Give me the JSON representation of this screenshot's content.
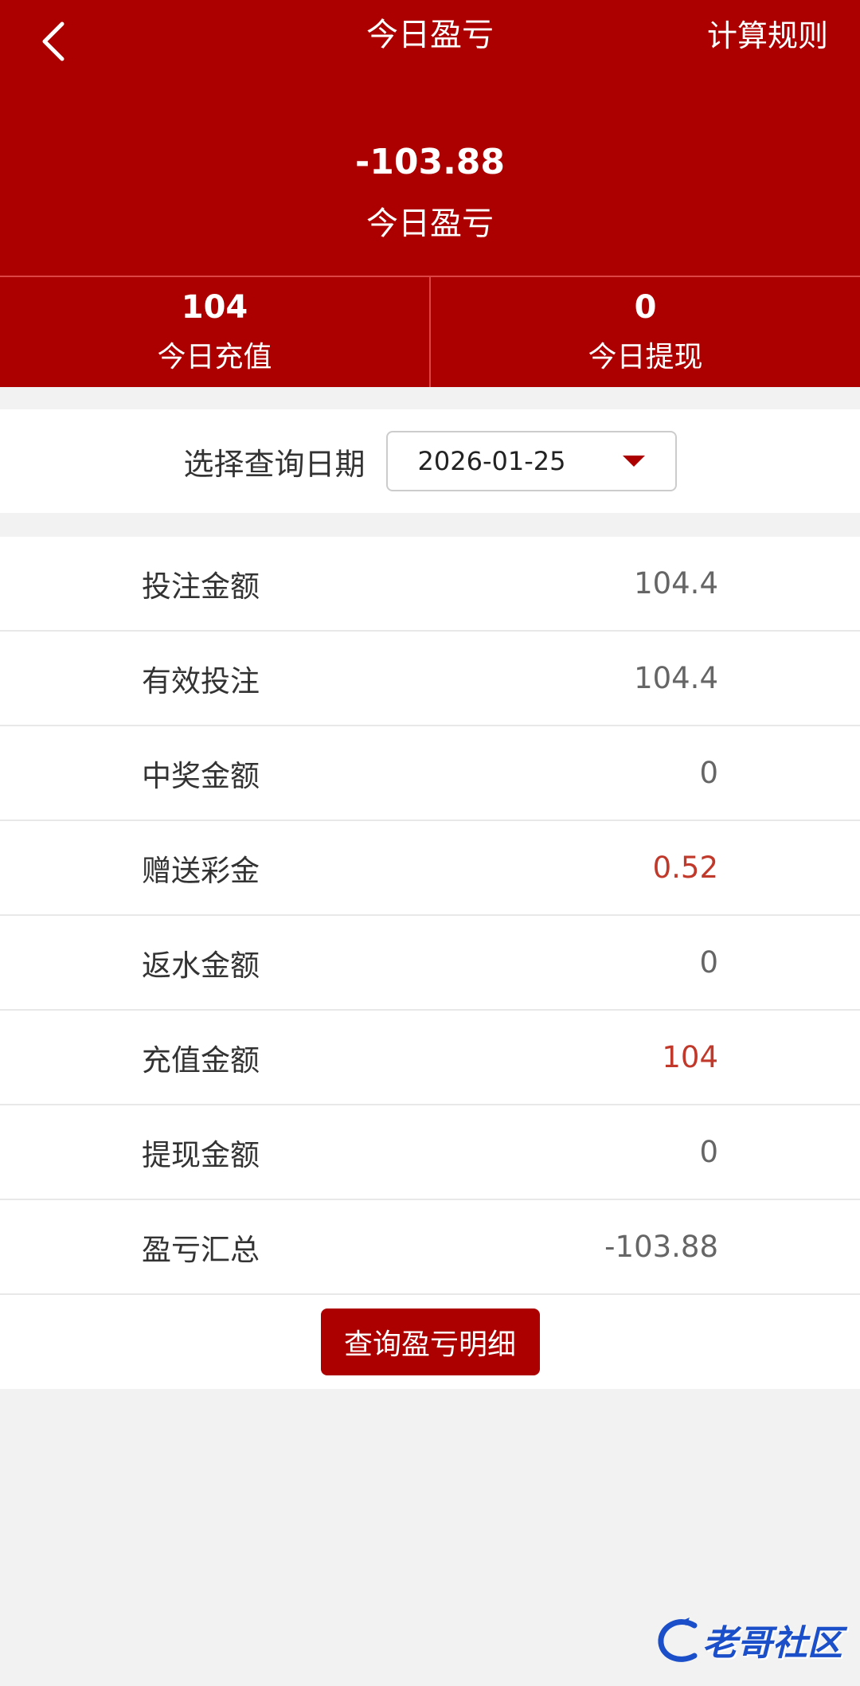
{
  "header": {
    "title": "今日盈亏",
    "rules_label": "计算规则",
    "total_value": "-103.88",
    "total_label": "今日盈亏"
  },
  "stats": [
    {
      "value": "104",
      "label": "今日充值"
    },
    {
      "value": "0",
      "label": "今日提现"
    }
  ],
  "date_filter": {
    "label": "选择查询日期",
    "value": "2026-01-25"
  },
  "rows": [
    {
      "label": "投注金额",
      "value": "104.4"
    },
    {
      "label": "有效投注",
      "value": "104.4"
    },
    {
      "label": "中奖金额",
      "value": "0"
    },
    {
      "label": "赠送彩金",
      "value": "0.52"
    },
    {
      "label": "返水金额",
      "value": "0"
    },
    {
      "label": "充值金额",
      "value": "104"
    },
    {
      "label": "提现金额",
      "value": "0"
    },
    {
      "label": "盈亏汇总",
      "value": "-103.88"
    }
  ],
  "detail_button": "查询盈亏明细",
  "watermark": "老哥社区",
  "colors": {
    "brand": "#ac0000",
    "highlight_value": "#c0392b"
  }
}
